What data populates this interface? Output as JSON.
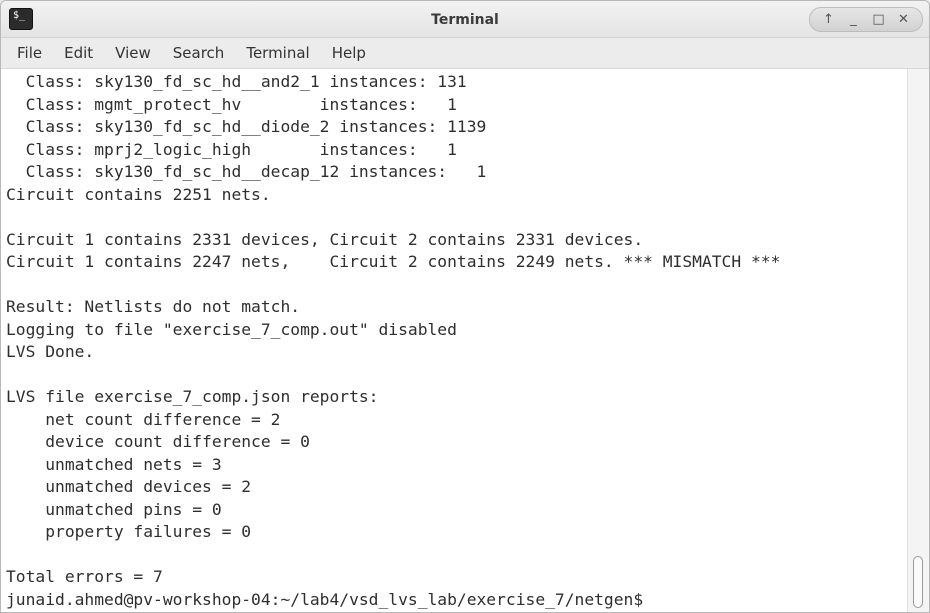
{
  "window": {
    "title": "Terminal",
    "app_icon_text": "$_",
    "controls": {
      "up": "↑",
      "minimize": "_",
      "maximize": "□",
      "close": "✕"
    }
  },
  "menu": {
    "file": "File",
    "edit": "Edit",
    "view": "View",
    "search": "Search",
    "terminal": "Terminal",
    "help": "Help"
  },
  "terminal": {
    "lines": [
      "  Class: sky130_fd_sc_hd__and2_1 instances: 131",
      "  Class: mgmt_protect_hv        instances:   1",
      "  Class: sky130_fd_sc_hd__diode_2 instances: 1139",
      "  Class: mprj2_logic_high       instances:   1",
      "  Class: sky130_fd_sc_hd__decap_12 instances:   1",
      "Circuit contains 2251 nets.",
      "",
      "Circuit 1 contains 2331 devices, Circuit 2 contains 2331 devices.",
      "Circuit 1 contains 2247 nets,    Circuit 2 contains 2249 nets. *** MISMATCH ***",
      "",
      "Result: Netlists do not match.",
      "Logging to file \"exercise_7_comp.out\" disabled",
      "LVS Done.",
      "",
      "LVS file exercise_7_comp.json reports:",
      "    net count difference = 2",
      "    device count difference = 0",
      "    unmatched nets = 3",
      "    unmatched devices = 2",
      "    unmatched pins = 0",
      "    property failures = 0",
      "",
      "Total errors = 7",
      "junaid.ahmed@pv-workshop-04:~/lab4/vsd_lvs_lab/exercise_7/netgen$"
    ]
  }
}
